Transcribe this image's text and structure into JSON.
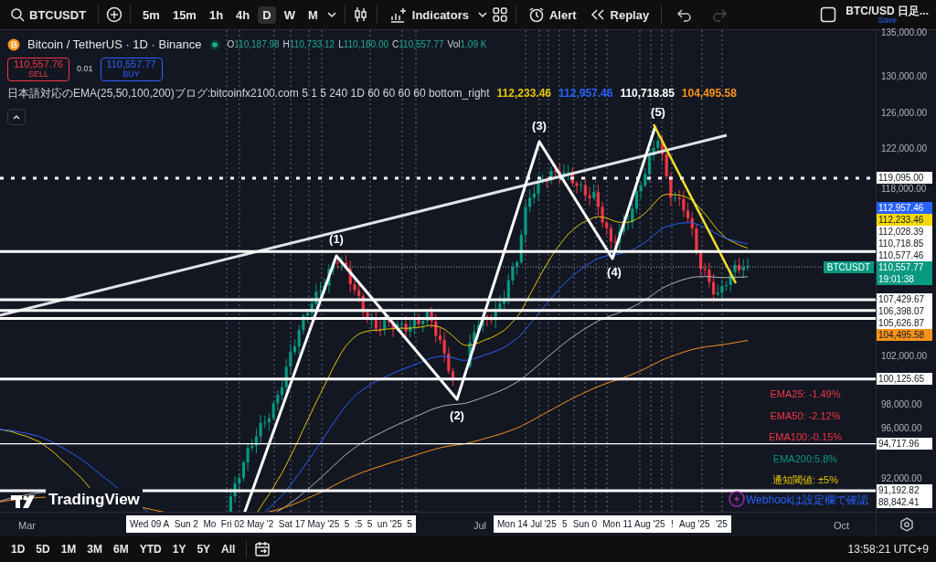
{
  "toolbar": {
    "symbol": "BTCUSDT",
    "intervals": [
      {
        "label": "5m",
        "selected": false
      },
      {
        "label": "15m",
        "selected": false
      },
      {
        "label": "1h",
        "selected": false
      },
      {
        "label": "4h",
        "selected": false
      },
      {
        "label": "D",
        "selected": true
      },
      {
        "label": "W",
        "selected": false
      },
      {
        "label": "M",
        "selected": false
      }
    ],
    "indicators": "Indicators",
    "alert": "Alert",
    "replay": "Replay",
    "history": [
      {
        "kind": "undo",
        "disabled": false
      },
      {
        "kind": "redo",
        "disabled": true
      }
    ],
    "layout": {
      "title": "BTC/USD 日足...",
      "status": "Save"
    }
  },
  "legend": {
    "title": "Bitcoin / TetherUS · 1D · Binance",
    "ohlc": [
      {
        "key": "O",
        "value": "110,187.98"
      },
      {
        "key": "H",
        "value": "110,733.12"
      },
      {
        "key": "L",
        "value": "110,180.00"
      },
      {
        "key": "C",
        "value": "110,557.77"
      },
      {
        "key": "Vol",
        "value": "1.09 K"
      }
    ],
    "sell": {
      "price": "110,557.76",
      "label": "SELL"
    },
    "spread": "0.01",
    "buy": {
      "price": "110,557.77",
      "label": "BUY"
    },
    "indicator": {
      "title": "日本語対応のEMA(25,50,100,200)ブログ:bitcoinfx2100.com 5 1 5 240 1D 60 60 60 60 bottom_right",
      "values": [
        {
          "text": "112,233.46",
          "color": "#e5c700"
        },
        {
          "text": "112,957.46",
          "color": "#2962ff"
        },
        {
          "text": "110,718.85",
          "color": "#ffffff"
        },
        {
          "text": "104,495.58",
          "color": "#f7931a"
        }
      ]
    }
  },
  "chart": {
    "wave_labels": [
      "(1)",
      "(2)",
      "(3)",
      "(4)",
      "(5)"
    ],
    "price_axis": [
      "135,000.00",
      "130,000.00",
      "126,000.00",
      "122,000.00",
      "118,000.00",
      "102,000.00",
      "98,000.00",
      "96,000.00",
      "92,000.00"
    ],
    "price_tags": [
      {
        "text": "119,095.00",
        "kind": "dotted",
        "color": "#ffffff"
      },
      {
        "text": "112,957.46",
        "kind": "ema",
        "color": "#2962ff"
      },
      {
        "text": "112,233.46",
        "kind": "ema",
        "color": "#f5d90a"
      },
      {
        "text": "112,028.39",
        "kind": "line",
        "color": "#ffffff"
      },
      {
        "text": "110,718.85",
        "kind": "ema",
        "color": "#ffffff"
      },
      {
        "text": "110,577.46",
        "kind": "none",
        "color": "#ffffff"
      },
      {
        "text": "110,557.77",
        "kind": "current",
        "color": "#089981",
        "countdown": "19:01:38",
        "symbol": "BTCUSDT"
      },
      {
        "text": "107,429.67",
        "kind": "line",
        "color": "#ffffff"
      },
      {
        "text": "106,398.07",
        "kind": "line",
        "color": "#ffffff"
      },
      {
        "text": "105,626.87",
        "kind": "line",
        "color": "#ffffff"
      },
      {
        "text": "104,495.58",
        "kind": "ema",
        "color": "#f7931a"
      },
      {
        "text": "100,125.65",
        "kind": "line",
        "color": "#ffffff"
      },
      {
        "text": "94,717.96",
        "kind": "thin_line",
        "color": "#ffffff"
      },
      {
        "text": "91,192.82",
        "kind": "line",
        "color": "#ffffff"
      },
      {
        "text": "88,842.41",
        "kind": "none",
        "color": "#ffffff"
      }
    ],
    "ema_panel": [
      {
        "text": "EMA25: -1.49%",
        "color": "#f23645"
      },
      {
        "text": "EMA50: -2.12%",
        "color": "#f23645"
      },
      {
        "text": "EMA100:-0.15%",
        "color": "#f23645"
      },
      {
        "text": "EMA200:5.8%",
        "color": "#089981"
      },
      {
        "text": "通知閾値: ±5%",
        "color": "#e5c700"
      }
    ],
    "webhook_note": "Webhookは設定欄で確認",
    "brand": "TradingView"
  },
  "time_axis": {
    "labels": [
      "Mar",
      "Jul",
      "Oct"
    ],
    "highlights": [
      [
        "Wed 09 A",
        "Sun 2",
        "Mo",
        "Fri 02 May '2",
        "Sat 17 May '25",
        "5",
        ":5",
        "5",
        "un '25",
        "5"
      ],
      [
        "Mon 14 Jul '25",
        "5",
        "Sun 0",
        "Mon 11 Aug '25",
        "!",
        "Aug '25",
        "'25"
      ]
    ]
  },
  "bottom_bar": {
    "ranges": [
      "1D",
      "5D",
      "1M",
      "3M",
      "6M",
      "YTD",
      "1Y",
      "5Y",
      "All"
    ],
    "clock": "13:58:21 UTC+9"
  }
}
